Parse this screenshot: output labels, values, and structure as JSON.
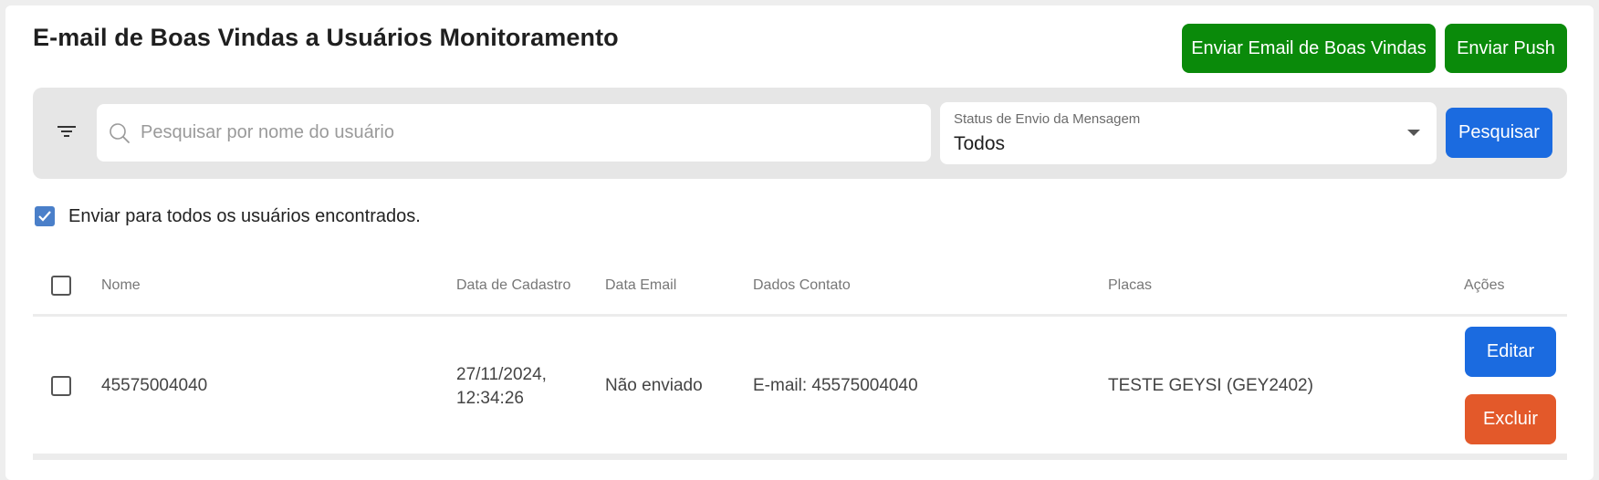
{
  "header": {
    "title": "E-mail de Boas Vindas a Usuários Monitoramento",
    "welcome_button": "Enviar Email de Boas Vindas",
    "push_button": "Enviar Push"
  },
  "filters": {
    "search_placeholder": "Pesquisar por nome do usuário",
    "search_value": "",
    "status_label": "Status de Envio da Mensagem",
    "status_value": "Todos",
    "search_button": "Pesquisar"
  },
  "send_all": {
    "label": "Enviar para todos os usuários encontrados.",
    "checked": true
  },
  "table": {
    "columns": [
      "Nome",
      "Data de Cadastro",
      "Data Email",
      "Dados Contato",
      "Placas",
      "Ações"
    ],
    "rows": [
      {
        "nome": "45575004040",
        "data_cadastro_date": "27/11/2024,",
        "data_cadastro_time": "12:34:26",
        "data_email": "Não enviado",
        "dados_contato": "E-mail: 45575004040",
        "placas": "TESTE GEYSI (GEY2402)",
        "edit_label": "Editar",
        "delete_label": "Excluir"
      }
    ]
  },
  "colors": {
    "green": "#0a8a0a",
    "blue": "#1b6be0",
    "orange": "#e3592a",
    "checkbox_checked": "#4a7fc9"
  }
}
